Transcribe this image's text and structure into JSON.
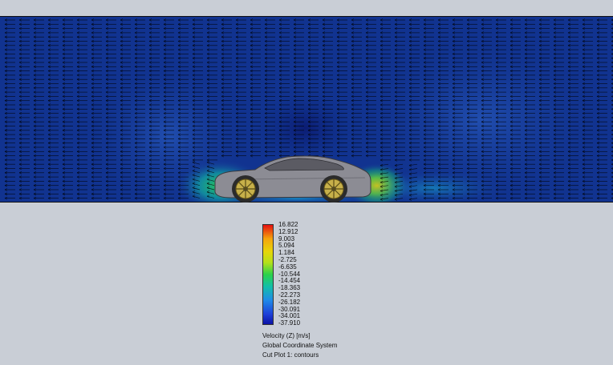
{
  "plot": {
    "quantity": "Velocity (Z) [m/s]",
    "coordinate_system": "Global Coordinate System",
    "plot_name": "Cut Plot 1: contours"
  },
  "legend": {
    "values": [
      "16.822",
      "12.912",
      "9.003",
      "5.094",
      "1.184",
      "-2.725",
      "-6.635",
      "-10.544",
      "-14.454",
      "-18.363",
      "-22.273",
      "-26.182",
      "-30.091",
      "-34.001",
      "-37.910"
    ],
    "colors": [
      "#e41010",
      "#f05a10",
      "#f5a50c",
      "#e6d60a",
      "#b4e01a",
      "#6ede32",
      "#2bd24a",
      "#16c878",
      "#12bfa8",
      "#18b0d6",
      "#1f8ae8",
      "#2463e6",
      "#1d3fd8",
      "#1424c0",
      "#0b12a6"
    ]
  },
  "colors": {
    "background": "#c9ced6",
    "flow_dark": "#0d2c86",
    "flow_mid": "#1a3fa0",
    "car_body": "#8c8c94",
    "wheel_rim": "#c7b04a"
  }
}
